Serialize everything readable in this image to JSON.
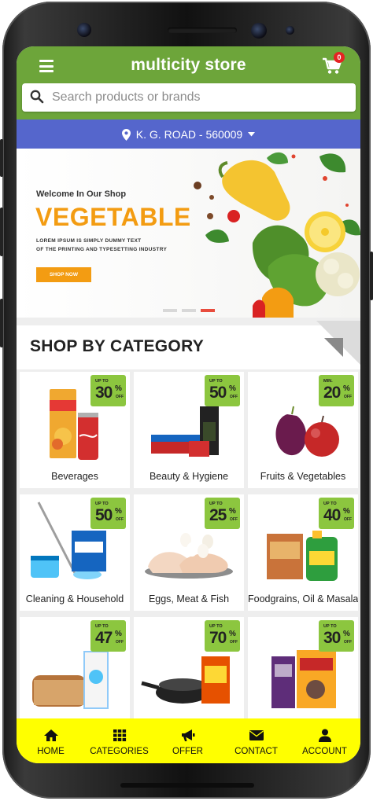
{
  "header": {
    "title": "multicity store",
    "cart_count": "0"
  },
  "search": {
    "placeholder": "Search products or brands"
  },
  "location": {
    "label": "K. G. ROAD - 560009"
  },
  "banner": {
    "welcome": "Welcome In Our Shop",
    "title": "VEGETABLE",
    "subtitle_line1": "LOREM IPSUM IS SIMPLY DUMMY TEXT",
    "subtitle_line2": "OF THE PRINTING AND TYPESETTING INDUSTRY",
    "button": "SHOP NOW",
    "slides": 3,
    "active_slide": 3
  },
  "category_section": {
    "title": "SHOP BY CATEGORY"
  },
  "categories": [
    {
      "name": "Beverages",
      "badge_prefix": "UP TO",
      "discount": "30",
      "icon": "beverages-icon"
    },
    {
      "name": "Beauty & Hygiene",
      "badge_prefix": "UP TO",
      "discount": "50",
      "icon": "beauty-icon"
    },
    {
      "name": "Fruits & Vegetables",
      "badge_prefix": "MIN.",
      "discount": "20",
      "icon": "fruits-icon"
    },
    {
      "name": "Cleaning & Household",
      "badge_prefix": "UP TO",
      "discount": "50",
      "icon": "cleaning-icon"
    },
    {
      "name": "Eggs, Meat & Fish",
      "badge_prefix": "UP TO",
      "discount": "25",
      "icon": "eggs-icon"
    },
    {
      "name": "Foodgrains, Oil & Masala",
      "badge_prefix": "UP TO",
      "discount": "40",
      "icon": "foodgrains-icon"
    },
    {
      "name": "",
      "badge_prefix": "UP TO",
      "discount": "47",
      "icon": "bakery-icon"
    },
    {
      "name": "",
      "badge_prefix": "UP TO",
      "discount": "70",
      "icon": "kitchen-icon"
    },
    {
      "name": "",
      "badge_prefix": "UP TO",
      "discount": "30",
      "icon": "snacks-icon"
    }
  ],
  "badge_suffix": {
    "percent": "%",
    "off": "OFF"
  },
  "bottom_nav": [
    {
      "label": "HOME",
      "icon": "home-icon"
    },
    {
      "label": "CATEGORIES",
      "icon": "grid-icon"
    },
    {
      "label": "OFFER",
      "icon": "megaphone-icon"
    },
    {
      "label": "CONTACT",
      "icon": "envelope-icon"
    },
    {
      "label": "ACCOUNT",
      "icon": "user-icon"
    }
  ],
  "colors": {
    "header": "#6da53a",
    "location_bar": "#5566cc",
    "accent_orange": "#f39c12",
    "badge_green": "#8cc63f",
    "bottom_nav": "#ffff00"
  }
}
